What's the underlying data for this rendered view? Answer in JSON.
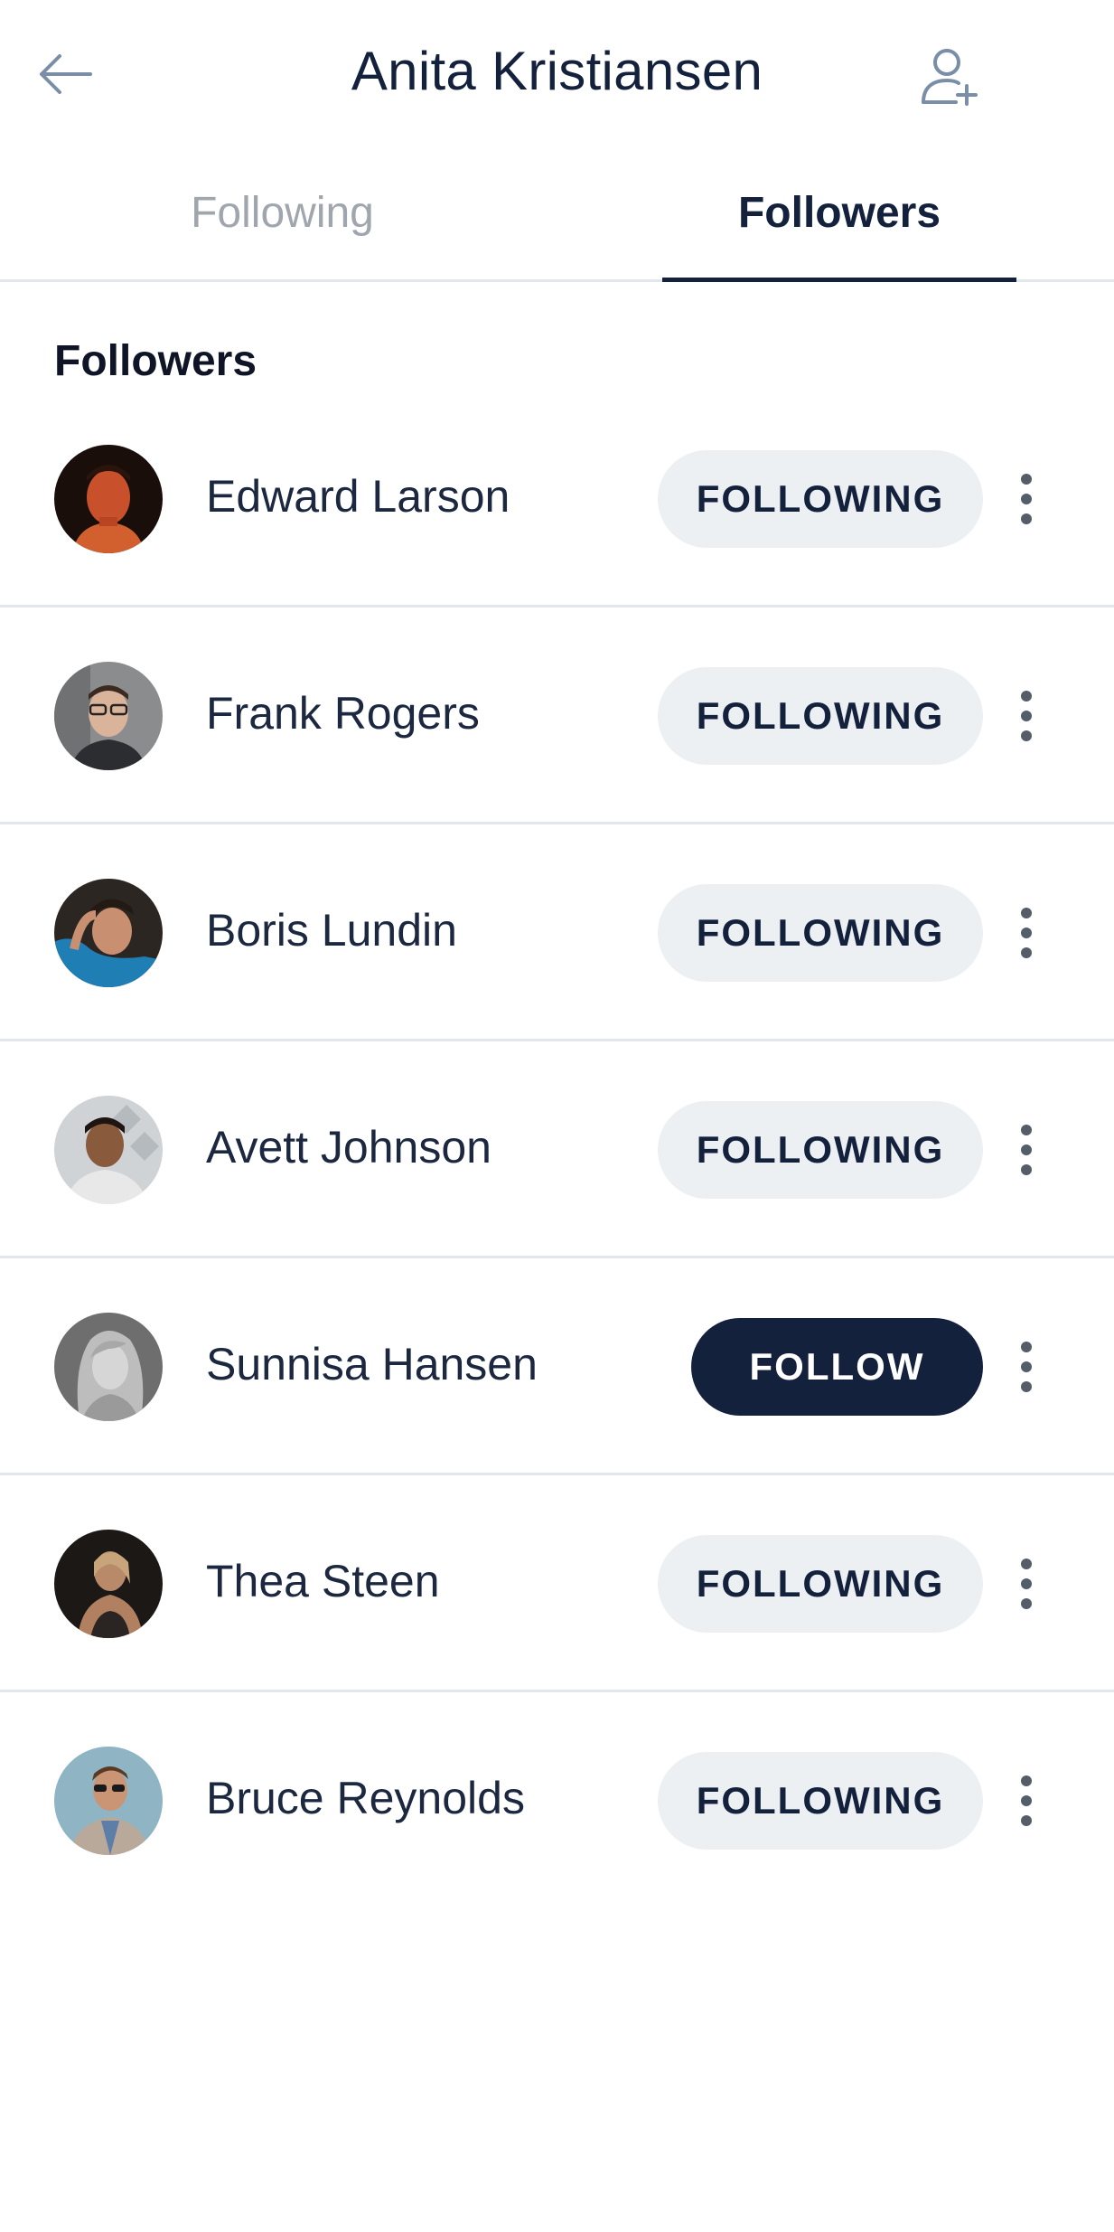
{
  "header": {
    "title": "Anita Kristiansen",
    "back_icon": "arrow-left-icon",
    "add_icon": "user-plus-icon"
  },
  "tabs": [
    {
      "label": "Following",
      "active": false
    },
    {
      "label": "Followers",
      "active": true
    }
  ],
  "section": {
    "title": "Followers"
  },
  "followers": [
    {
      "name": "Edward Larson",
      "button": "FOLLOWING",
      "state": "following"
    },
    {
      "name": "Frank Rogers",
      "button": "FOLLOWING",
      "state": "following"
    },
    {
      "name": "Boris Lundin",
      "button": "FOLLOWING",
      "state": "following"
    },
    {
      "name": "Avett Johnson",
      "button": "FOLLOWING",
      "state": "following"
    },
    {
      "name": "Sunnisa Hansen",
      "button": "FOLLOW",
      "state": "follow"
    },
    {
      "name": "Thea Steen",
      "button": "FOLLOWING",
      "state": "following"
    },
    {
      "name": "Bruce Reynolds",
      "button": "FOLLOWING",
      "state": "following"
    }
  ],
  "colors": {
    "primary": "#14213d",
    "muted_tab": "#a0a6ae",
    "pill_bg": "#edf0f3",
    "divider": "#e3e6ea",
    "icon": "#7b8ea8"
  }
}
